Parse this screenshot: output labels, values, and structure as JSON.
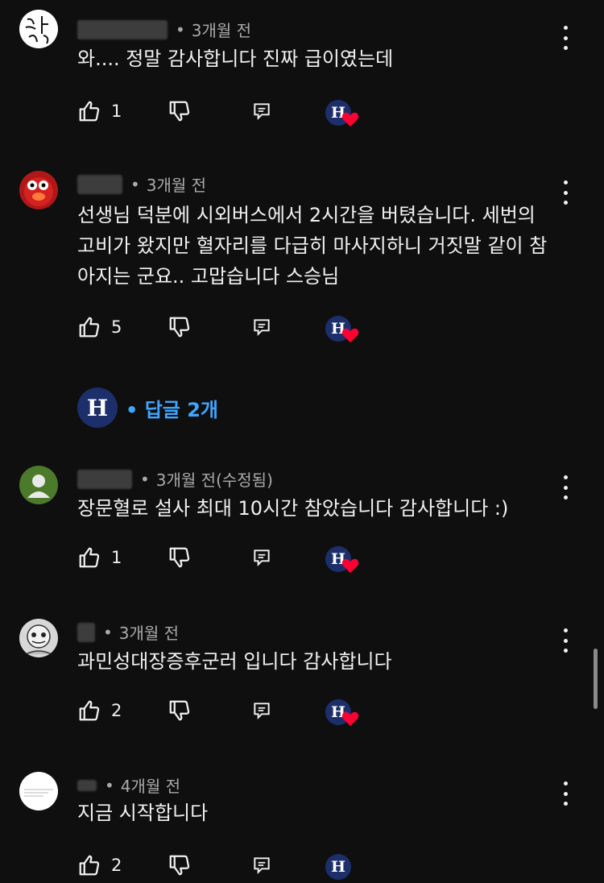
{
  "comments": [
    {
      "author_masked": "███ ███",
      "time": "3개월 전",
      "text": "와.... 정말 감사합니다 진짜 급이였는데",
      "likes": "1",
      "avatar_text": "나 성"
    },
    {
      "author_masked": "███",
      "time": "3개월 전",
      "text": "선생님 덕분에 시외버스에서 2시간을 버텼습니다. 세번의 고비가 왔지만 혈자리를 다급히 마사지하니 거짓말 같이 참아지는 군요.. 고맙습니다 스승님",
      "likes": "5",
      "replies_label": "답글 2개"
    },
    {
      "author_masked": "███",
      "time": "3개월 전(수정됨)",
      "text": "장문혈로 설사 최대 10시간 참았습니다 감사합니다 :)",
      "likes": "1"
    },
    {
      "author_masked": "█",
      "time": "3개월 전",
      "text": "과민성대장증후군러 입니다 감사합니다",
      "likes": "2"
    },
    {
      "author_masked": "█",
      "time": "4개월 전",
      "text": "지금 시작합니다",
      "likes": "2"
    }
  ],
  "creator_badge_letter": "H",
  "colors": {
    "link": "#3ea6ff",
    "heart": "#ff0033",
    "badge": "#1d2f6b"
  }
}
